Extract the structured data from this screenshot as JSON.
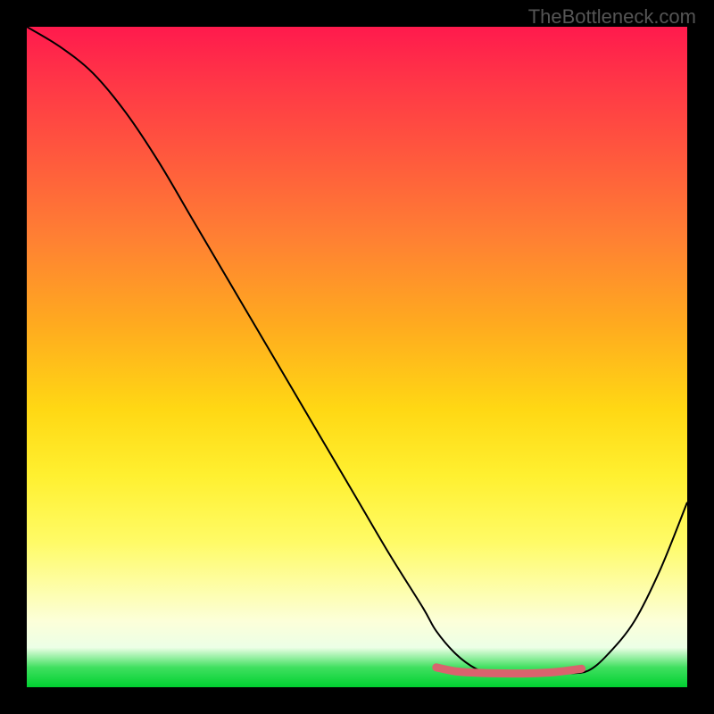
{
  "watermark": "TheBottleneck.com",
  "chart_data": {
    "type": "line",
    "title": "",
    "xlabel": "",
    "ylabel": "",
    "xlim": [
      0,
      100
    ],
    "ylim": [
      0,
      100
    ],
    "series": [
      {
        "name": "bottleneck-curve",
        "x": [
          0,
          5,
          10,
          15,
          20,
          25,
          30,
          35,
          40,
          45,
          50,
          55,
          60,
          62,
          65,
          68,
          70,
          73,
          76,
          79,
          82,
          85,
          88,
          92,
          96,
          100
        ],
        "y": [
          100,
          97,
          93,
          87,
          79.5,
          71,
          62.5,
          54,
          45.5,
          37,
          28.5,
          20,
          12,
          8.5,
          5,
          2.8,
          2.3,
          2.1,
          2.0,
          2.0,
          2.1,
          2.5,
          5,
          10,
          18,
          28
        ]
      },
      {
        "name": "optimal-range-marker",
        "x": [
          62,
          65,
          68,
          72,
          76,
          80,
          84
        ],
        "y": [
          3.0,
          2.4,
          2.2,
          2.1,
          2.1,
          2.3,
          2.8
        ]
      }
    ],
    "colors": {
      "curve": "#000000",
      "marker": "#d9636e"
    }
  }
}
